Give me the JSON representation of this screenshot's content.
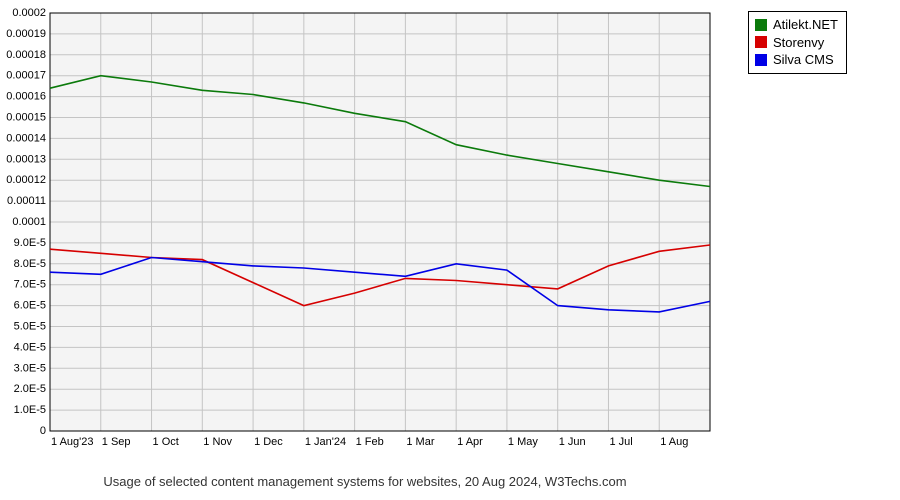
{
  "chart_data": {
    "type": "line",
    "title": "",
    "xlabel": "",
    "ylabel": "",
    "ylim": [
      0,
      0.0002
    ],
    "y_ticks": [
      0,
      1e-05,
      2e-05,
      3e-05,
      4e-05,
      5e-05,
      6e-05,
      7e-05,
      8e-05,
      9e-05,
      0.0001,
      0.00011,
      0.00012,
      0.00013,
      0.00014,
      0.00015,
      0.00016,
      0.00017,
      0.00018,
      0.00019,
      0.0002
    ],
    "y_tick_labels": [
      "0",
      "1.0E-5",
      "2.0E-5",
      "3.0E-5",
      "4.0E-5",
      "5.0E-5",
      "6.0E-5",
      "7.0E-5",
      "8.0E-5",
      "9.0E-5",
      "0.0001",
      "0.00011",
      "0.00012",
      "0.00013",
      "0.00014",
      "0.00015",
      "0.00016",
      "0.00017",
      "0.00018",
      "0.00019",
      "0.0002"
    ],
    "categories": [
      "1 Aug'23",
      "1 Sep",
      "1 Oct",
      "1 Nov",
      "1 Dec",
      "1 Jan'24",
      "1 Feb",
      "1 Mar",
      "1 Apr",
      "1 May",
      "1 Jun",
      "1 Jul",
      "1 Aug",
      ""
    ],
    "series": [
      {
        "name": "Atilekt.NET",
        "color": "#0b7a0b",
        "values": [
          0.000164,
          0.00017,
          0.000167,
          0.000163,
          0.000161,
          0.000157,
          0.000152,
          0.000148,
          0.000137,
          0.000132,
          0.000128,
          0.000124,
          0.00012,
          0.000117
        ]
      },
      {
        "name": "Storenvy",
        "color": "#d60000",
        "values": [
          8.7e-05,
          8.5e-05,
          8.3e-05,
          8.2e-05,
          7.1e-05,
          6e-05,
          6.6e-05,
          7.3e-05,
          7.2e-05,
          7e-05,
          6.8e-05,
          7.9e-05,
          8.6e-05,
          8.9e-05
        ]
      },
      {
        "name": "Silva CMS",
        "color": "#0000e6",
        "values": [
          7.6e-05,
          7.5e-05,
          8.3e-05,
          8.1e-05,
          7.9e-05,
          7.8e-05,
          7.6e-05,
          7.4e-05,
          8e-05,
          7.7e-05,
          6e-05,
          5.8e-05,
          5.7e-05,
          6.2e-05
        ]
      }
    ],
    "legend_position": "top-right",
    "grid": true
  },
  "caption": "Usage of selected content management systems for websites, 20 Aug 2024, W3Techs.com"
}
